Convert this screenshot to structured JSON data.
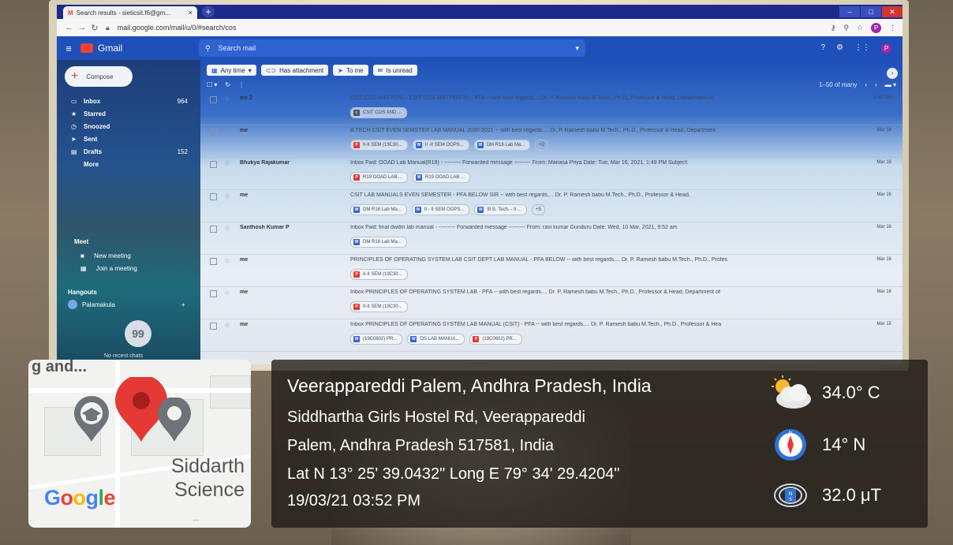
{
  "browser": {
    "tab_title": "Search results - sieticsit.f6@gm...",
    "tab_close": "×",
    "new_tab": "+",
    "url": "mail.google.com/mail/u/0/#search/cos",
    "profile_initial": "P"
  },
  "gmail": {
    "logo_text": "Gmail",
    "search_placeholder": "Search mail",
    "profile_initial": "P",
    "compose_label": "Compose",
    "nav": [
      {
        "label": "Inbox",
        "count": "964"
      },
      {
        "label": "Starred",
        "count": ""
      },
      {
        "label": "Snoozed",
        "count": ""
      },
      {
        "label": "Sent",
        "count": ""
      },
      {
        "label": "Drafts",
        "count": "152"
      },
      {
        "label": "More",
        "count": ""
      }
    ],
    "meet": {
      "title": "Meet",
      "new_meeting": "New meeting",
      "join": "Join a meeting"
    },
    "hangouts": {
      "title": "Hangouts",
      "user": "Palamakula",
      "quote": "99",
      "no_chats": "No recent chats"
    },
    "filters": [
      "Any time",
      "Has attachment",
      "To me",
      "Is unread"
    ],
    "range": "1–50 of many",
    "emails": [
      {
        "sender": "me 2",
        "subject": "CSIT COS AND POS -- CSIT COS AND POS To: , PFA -- with best regards.... Dr. P. Ramesh babu M.Tech., Ph.D., Professor & Head, Department of",
        "date": "3:50 PM",
        "atts": [
          {
            "t": "gen",
            "n": "CSIT COS AND ..."
          }
        ],
        "more": ""
      },
      {
        "sender": "me",
        "subject": "B.TECH CSIT EVEN SEMSTER LAB MANUAL 2020-2021 -- with best regards.... Dr. P. Ramesh babu M.Tech., Ph.D., Professor & Head, Department",
        "date": "Mar 16",
        "atts": [
          {
            "t": "pdf",
            "n": "II-II SEM (19C30..."
          },
          {
            "t": "doc",
            "n": "II -II SEM OOPS..."
          },
          {
            "t": "doc",
            "n": "DM R18 Lab Ma..."
          }
        ],
        "more": "+2"
      },
      {
        "sender": "Bhukya Rajakumar",
        "subject": "Inbox  Fwd: OOAD Lab Manual(R19) - --------- Forwarded message --------- From: Manasa Priya Date: Tue, Mar 16, 2021, 1:49 PM Subject:",
        "date": "Mar 16",
        "atts": [
          {
            "t": "pdf",
            "n": "R19 OOAD LAB ..."
          },
          {
            "t": "doc",
            "n": "R19 OOAD LAB ..."
          }
        ],
        "more": ""
      },
      {
        "sender": "me",
        "subject": "CSIT LAB MANUALS EVEN SEMESTER - PFA BELOW SIR -- with best regards.... Dr. P. Ramesh babu M.Tech., Ph.D., Professor & Head,",
        "date": "Mar 16",
        "atts": [
          {
            "t": "doc",
            "n": "DM R18 Lab Ma..."
          },
          {
            "t": "doc",
            "n": "II - II SEM OOPS..."
          },
          {
            "t": "doc",
            "n": "III B. Tech. - II ..."
          }
        ],
        "more": "+5"
      },
      {
        "sender": "Santhosh Kumar P",
        "subject": "Inbox  Fwd: final dwdm lab manual - --------- Forwarded message --------- From: ravi kumar Gunduru Date: Wed, 10 Mar, 2021, 9:52 am",
        "date": "Mar 16",
        "atts": [
          {
            "t": "doc",
            "n": "DM R18 Lab Ma..."
          }
        ],
        "more": ""
      },
      {
        "sender": "me",
        "subject": "PRINCIPLES OF OPERATING SYSTEM LAB CSIT DEPT LAB MANUAL - PFA BELOW -- with best regards.... Dr. P. Ramesh babu M.Tech., Ph.D., Profes",
        "date": "Mar 16",
        "atts": [
          {
            "t": "pdf",
            "n": "II-II SEM (19C30..."
          }
        ],
        "more": ""
      },
      {
        "sender": "me",
        "subject": "Inbox  PRINCIPLES OF OPERATING SYSTEM LAB - PFA -- with best regards.... Dr. P. Ramesh babu M.Tech., Ph.D., Professor & Head, Department of",
        "date": "Mar 16",
        "atts": [
          {
            "t": "pdf",
            "n": "II-II SEM (19C30..."
          }
        ],
        "more": ""
      },
      {
        "sender": "me",
        "subject": "Inbox  PRINCIPLES OF OPERATING SYSTEM LAB MANUAL (CSIT) - PFA -- with best regards.... Dr. P. Ramesh babu M.Tech., Ph.D., Professor & Hea",
        "date": "Mar 15",
        "atts": [
          {
            "t": "doc",
            "n": "(19C0602) PR..."
          },
          {
            "t": "doc",
            "n": "OS LAB MANUA..."
          },
          {
            "t": "pdf",
            "n": "(19C0602) PR..."
          }
        ],
        "more": ""
      }
    ]
  },
  "map": {
    "partial_label": "g and...",
    "place_line1": "Siddarth",
    "place_line2": "Science",
    "logo": [
      "G",
      "o",
      "o",
      "g",
      "l",
      "e"
    ],
    "dots": "..."
  },
  "location": {
    "title": "Veerappareddi Palem, Andhra Pradesh, India",
    "address_line1": "Siddhartha Girls Hostel Rd, Veerappareddi",
    "address_line2": "Palem, Andhra Pradesh 517581, India",
    "coords": "Lat N 13° 25' 39.0432\" Long E 79° 34' 29.4204\"",
    "datetime": "19/03/21 03:52 PM"
  },
  "metrics": {
    "temperature": "34.0° C",
    "heading": "14° N",
    "magnetic": "32.0 μT"
  },
  "colors": {
    "gmail_blue": "#1f4fb8",
    "pin_red": "#e53935",
    "pin_gray": "#6d7378"
  }
}
